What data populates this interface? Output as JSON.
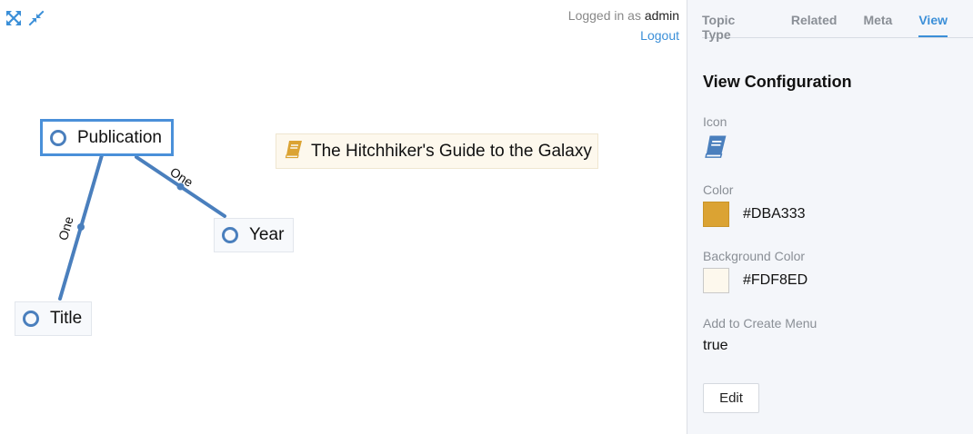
{
  "toolbar": {
    "icons": [
      "expand-icon",
      "compress-icon"
    ]
  },
  "login": {
    "prefix": "Logged in as",
    "username": "admin",
    "logout_label": "Logout"
  },
  "graph": {
    "topics": {
      "publication": "Publication",
      "year": "Year",
      "title": "Title",
      "book": "The Hitchhiker's Guide to the Galaxy"
    },
    "associations": {
      "publication_year": "One",
      "publication_title": "One"
    },
    "edge_color": "#4a7fbd"
  },
  "panel": {
    "tabs": [
      "Topic Type",
      "Related",
      "Meta",
      "View"
    ],
    "active_tab": "View",
    "heading": "View Configuration",
    "icon": {
      "label": "Icon",
      "name": "book-icon"
    },
    "color": {
      "label": "Color",
      "value": "#DBA333"
    },
    "background_color": {
      "label": "Background Color",
      "value": "#FDF8ED"
    },
    "create_menu": {
      "label": "Add to Create Menu",
      "value": "true"
    },
    "edit_label": "Edit"
  },
  "colors": {
    "accent": "#3b8fd8",
    "topic_icon": "#4a7fbd",
    "book_icon": "#DBA333",
    "book_background": "#FDF8ED"
  }
}
